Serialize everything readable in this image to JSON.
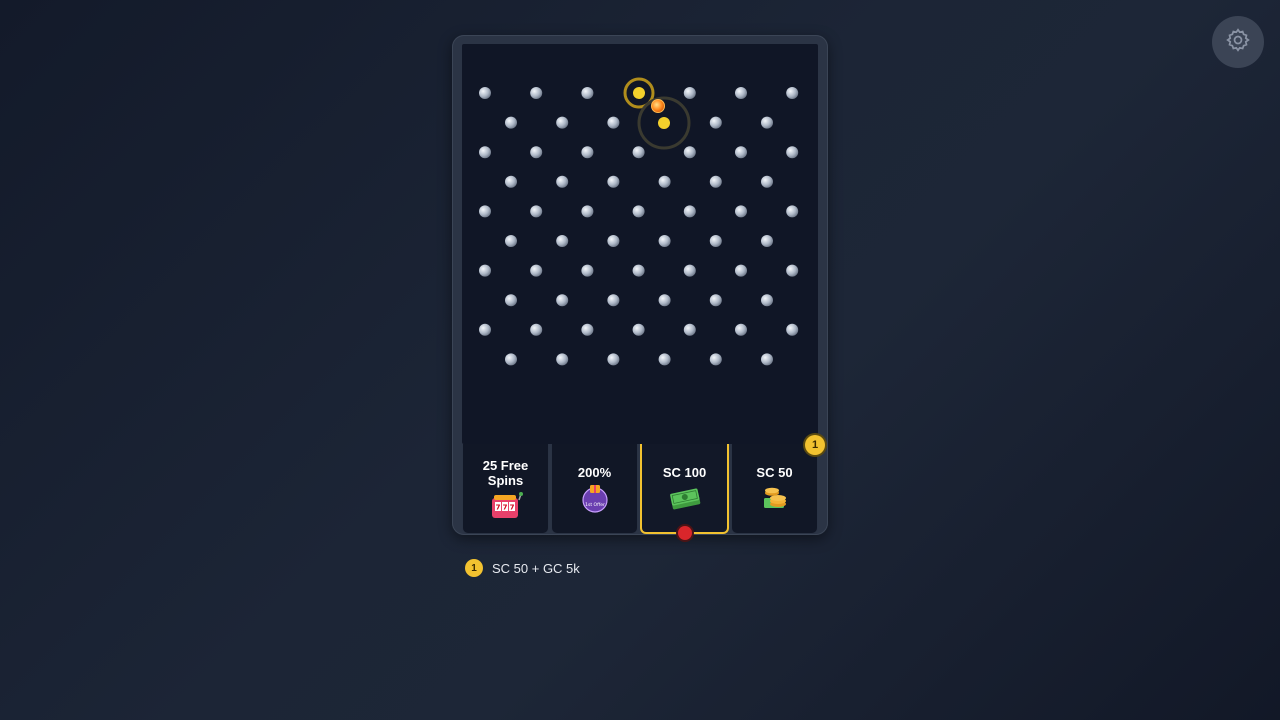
{
  "settings": {
    "icon": "gear-icon"
  },
  "board": {
    "buckets": [
      {
        "label": "25 Free Spins",
        "icon": "slot-machine-icon",
        "active": false
      },
      {
        "label": "200%",
        "icon": "offer-badge-icon",
        "icon_text": "1st Offer",
        "active": false
      },
      {
        "label": "SC 100",
        "icon": "cash-stack-icon",
        "active": true
      },
      {
        "label": "SC 50",
        "icon": "coin-stack-icon",
        "active": false,
        "badge": "1"
      }
    ]
  },
  "legend": {
    "badge": "1",
    "text": "SC 50 + GC 5k"
  },
  "colors": {
    "accent": "#f2c230",
    "marker": "#d9262b",
    "background": "#1c2536"
  }
}
